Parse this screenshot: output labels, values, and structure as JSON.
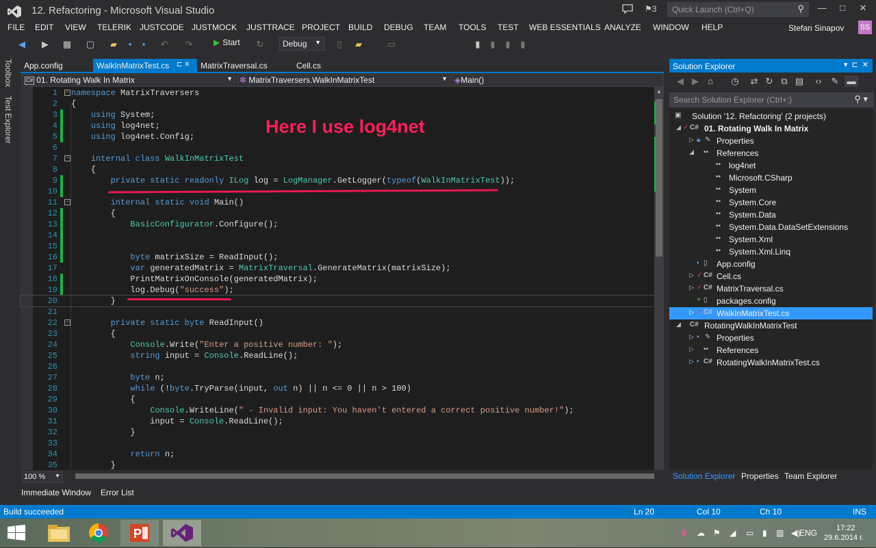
{
  "window": {
    "title": "12. Refactoring - Microsoft Visual Studio",
    "notifications_count": "3",
    "quick_launch_placeholder": "Quick Launch (Ctrl+Q)",
    "minimize": "—",
    "maximize": "□",
    "close": "✕"
  },
  "menu": [
    "FILE",
    "EDIT",
    "VIEW",
    "TELERIK",
    "JUSTCODE",
    "JUSTMOCK",
    "JUSTTRACE",
    "PROJECT",
    "BUILD",
    "DEBUG",
    "TEAM",
    "TOOLS",
    "TEST",
    "WEB ESSENTIALS",
    "ANALYZE",
    "WINDOW",
    "HELP"
  ],
  "user": {
    "name": "Stefan Sinapov",
    "initials": "SS"
  },
  "toolbar": {
    "start_label": "Start",
    "config": "Debug"
  },
  "side_tabs": [
    "Toolbox",
    "Test Explorer"
  ],
  "doc_tabs": [
    "App.config",
    "WalkInMatrixTest.cs",
    "MatrixTraversal.cs",
    "Cell.cs"
  ],
  "active_tab_pin": "⊏ ✕",
  "nav": {
    "project": "01. Rotating Walk In Matrix",
    "type": "MatrixTraversers.WalkInMatrixTest",
    "member": "Main()"
  },
  "annotation": "Here I use log4net",
  "zoom": "100 %",
  "bottom_tabs": [
    "Immediate Window",
    "Error List"
  ],
  "solution_explorer": {
    "title": "Solution Explorer",
    "search_placeholder": "Search Solution Explorer (Ctrl+;)",
    "items": [
      {
        "label": "Solution '12. Refactoring' (2 projects)"
      },
      {
        "label": "01. Rotating Walk In Matrix"
      },
      {
        "label": "Properties"
      },
      {
        "label": "References"
      },
      {
        "label": "log4net"
      },
      {
        "label": "Microsoft.CSharp"
      },
      {
        "label": "System"
      },
      {
        "label": "System.Core"
      },
      {
        "label": "System.Data"
      },
      {
        "label": "System.Data.DataSetExtensions"
      },
      {
        "label": "System.Xml"
      },
      {
        "label": "System.Xml.Linq"
      },
      {
        "label": "App.config"
      },
      {
        "label": "Cell.cs"
      },
      {
        "label": "MatrixTraversal.cs"
      },
      {
        "label": "packages.config"
      },
      {
        "label": "WalkInMatrixTest.cs"
      },
      {
        "label": "RotatingWalkInMatrixTest"
      },
      {
        "label": "Properties"
      },
      {
        "label": "References"
      },
      {
        "label": "RotatingWalkInMatrixTest.cs"
      }
    ],
    "bottom_tabs": [
      "Solution Explorer",
      "Properties",
      "Team Explorer"
    ]
  },
  "status": {
    "message": "Build succeeded",
    "ln": "Ln 20",
    "col": "Col 10",
    "ch": "Ch 10",
    "mode": "INS"
  },
  "taskbar": {
    "lang": "ENG",
    "time": "17:22",
    "date": "29.6.2014 г."
  },
  "code": [
    {
      "n": "1",
      "t": "namespace MatrixTraversers"
    },
    {
      "n": "2",
      "t": "{"
    },
    {
      "n": "3",
      "t": "    using System;"
    },
    {
      "n": "4",
      "t": "    using log4net;"
    },
    {
      "n": "5",
      "t": "    using log4net.Config;"
    },
    {
      "n": "6",
      "t": ""
    },
    {
      "n": "7",
      "t": "    internal class WalkInMatrixTest"
    },
    {
      "n": "8",
      "t": "    {"
    },
    {
      "n": "9",
      "t": "        private static readonly ILog log = LogManager.GetLogger(typeof(WalkInMatrixTest));"
    },
    {
      "n": "10",
      "t": ""
    },
    {
      "n": "11",
      "t": "        internal static void Main()"
    },
    {
      "n": "12",
      "t": "        {"
    },
    {
      "n": "13",
      "t": "            BasicConfigurator.Configure();"
    },
    {
      "n": "14",
      "t": ""
    },
    {
      "n": "15",
      "t": ""
    },
    {
      "n": "16",
      "t": "            byte matrixSize = ReadInput();"
    },
    {
      "n": "17",
      "t": "            var generatedMatrix = MatrixTraversal.GenerateMatrix(matrixSize);"
    },
    {
      "n": "18",
      "t": "            PrintMatrixOnConsole(generatedMatrix);"
    },
    {
      "n": "19",
      "t": "            log.Debug(\"success\");"
    },
    {
      "n": "20",
      "t": "        }"
    },
    {
      "n": "21",
      "t": ""
    },
    {
      "n": "22",
      "t": "        private static byte ReadInput()"
    },
    {
      "n": "23",
      "t": "        {"
    },
    {
      "n": "24",
      "t": "            Console.Write(\"Enter a positive number: \");"
    },
    {
      "n": "25",
      "t": "            string input = Console.ReadLine();"
    },
    {
      "n": "26",
      "t": ""
    },
    {
      "n": "27",
      "t": "            byte n;"
    },
    {
      "n": "28",
      "t": "            while (!byte.TryParse(input, out n) || n <= 0 || n > 100)"
    },
    {
      "n": "29",
      "t": "            {"
    },
    {
      "n": "30",
      "t": "                Console.WriteLine(\" - Invalid input: You haven't entered a correct positive number!\");"
    },
    {
      "n": "31",
      "t": "                input = Console.ReadLine();"
    },
    {
      "n": "32",
      "t": "            }"
    },
    {
      "n": "33",
      "t": ""
    },
    {
      "n": "34",
      "t": "            return n;"
    },
    {
      "n": "35",
      "t": "        }"
    }
  ]
}
